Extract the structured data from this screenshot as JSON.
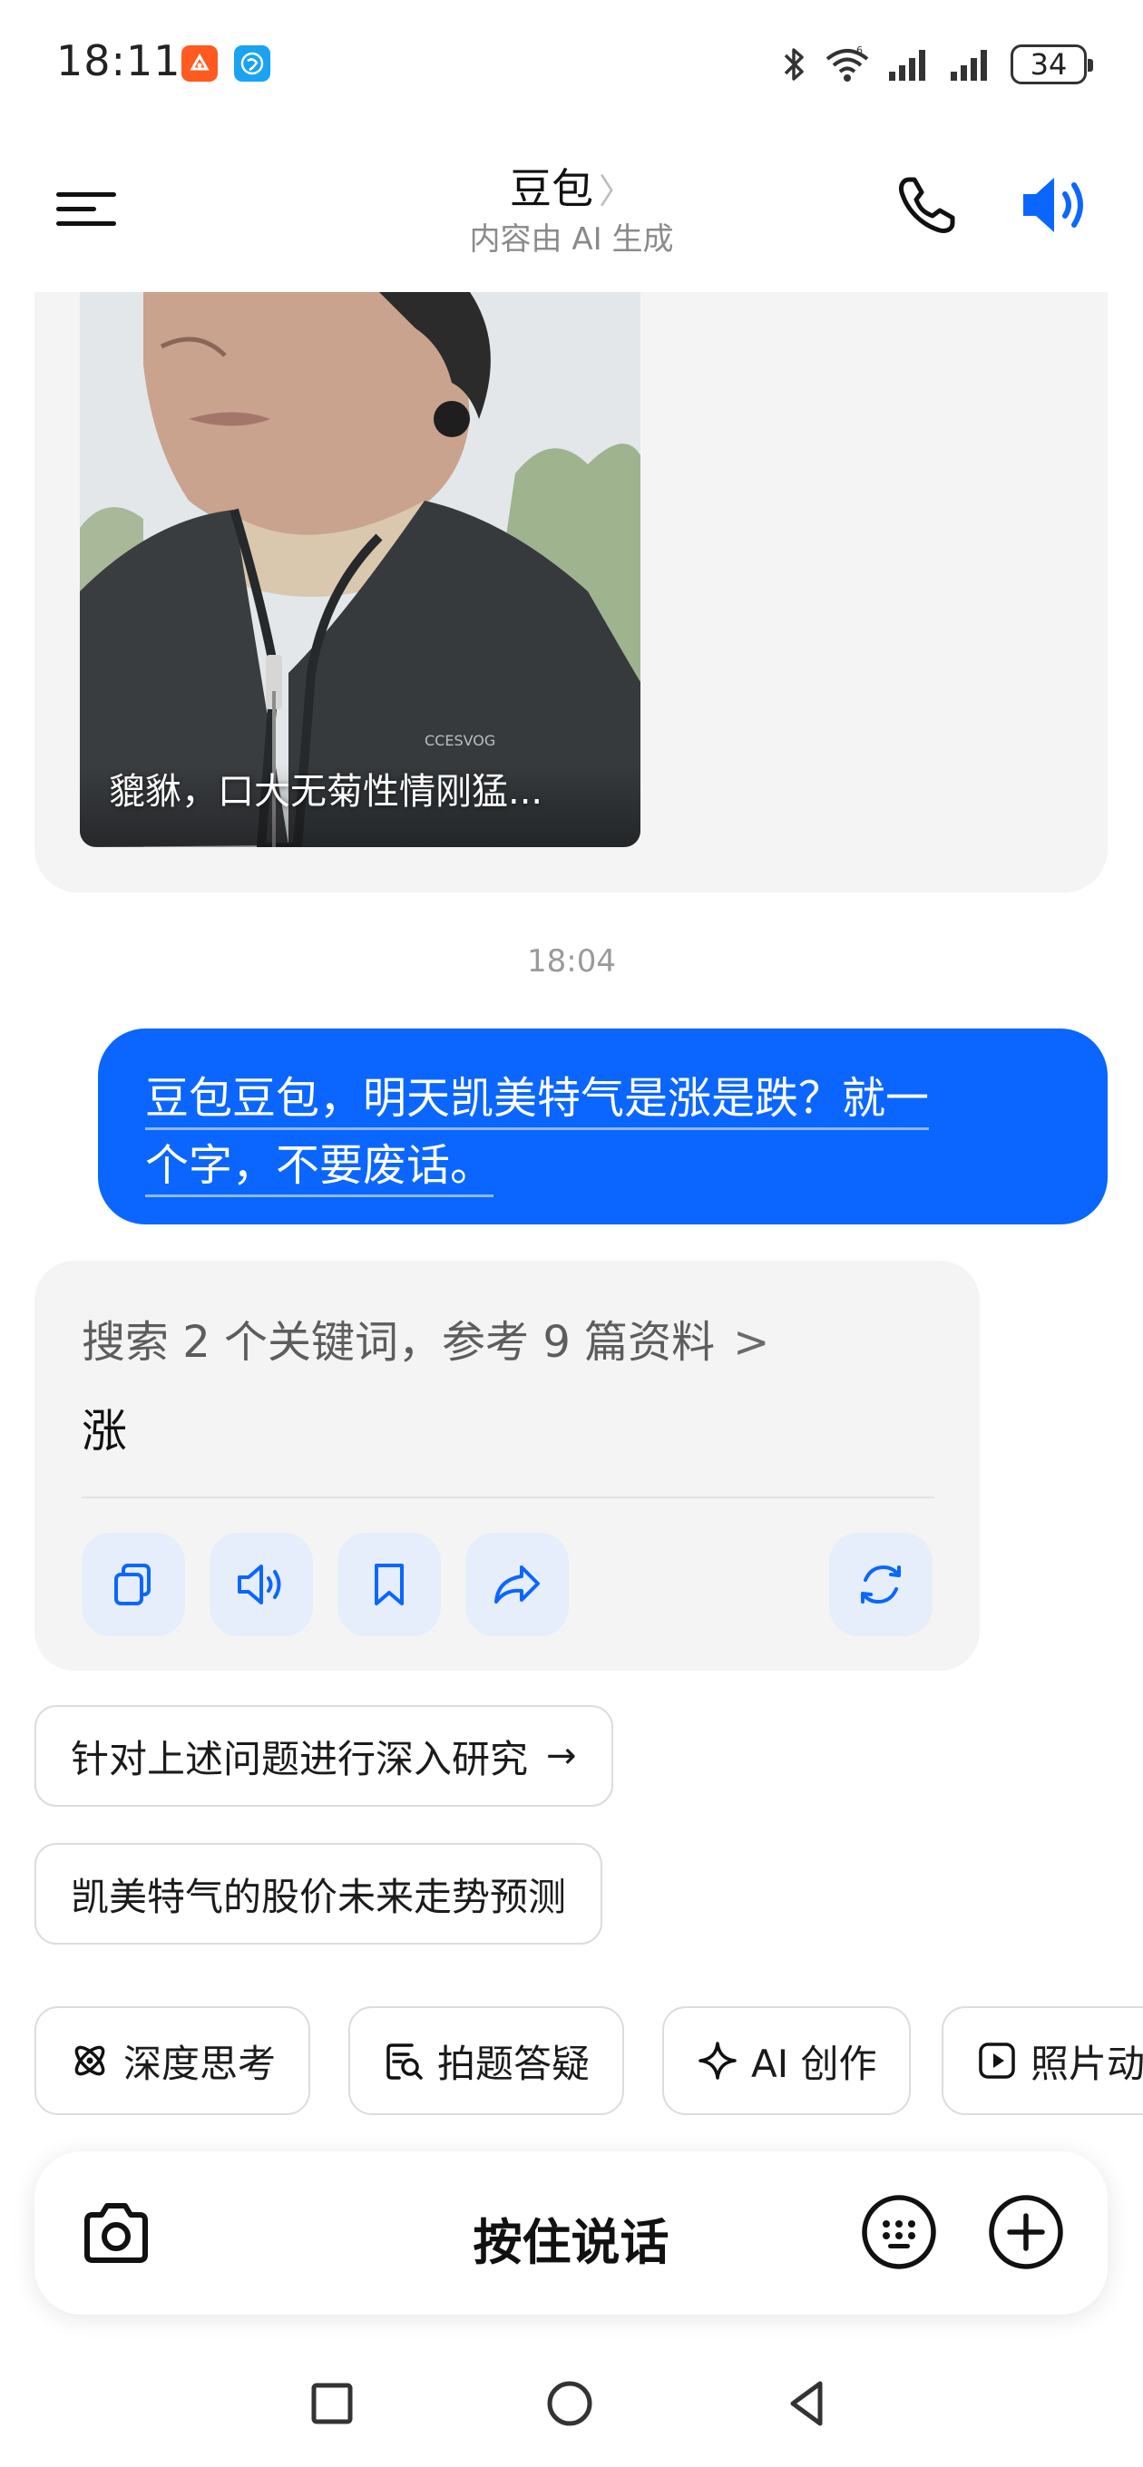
{
  "status_bar": {
    "time": "18:11",
    "battery": "34",
    "icons": [
      "orange-app-icon",
      "browser-app-icon",
      "bluetooth-icon",
      "wifi-icon",
      "signal-icon",
      "signal-icon",
      "battery-icon"
    ]
  },
  "header": {
    "title": "豆包",
    "chevron": "〉",
    "subtitle": "内容由 AI 生成"
  },
  "image_message": {
    "caption": "貔貅，口大无菊性情刚猛...",
    "shirt_text": "CCESVOG"
  },
  "timestamp": "18:04",
  "user_message": {
    "line1": "豆包豆包，明天凯美特气是涨是跌？就一",
    "line2": "个字，不要废话。"
  },
  "ai_reply": {
    "search_summary": "搜索 2 个关键词，参考 9 篇资料",
    "chevron": ">",
    "answer": "涨",
    "actions": [
      "copy-icon",
      "read-aloud-icon",
      "bookmark-icon",
      "share-icon",
      "regenerate-icon"
    ]
  },
  "suggestions": [
    {
      "label": "针对上述问题进行深入研究",
      "arrow": "→"
    },
    {
      "label": "凯美特气的股价未来走势预测"
    }
  ],
  "chips": [
    {
      "label": "深度思考",
      "icon": "atom-icon"
    },
    {
      "label": "拍题答疑",
      "icon": "scan-question-icon"
    },
    {
      "label": "AI 创作",
      "icon": "sparkle-icon"
    },
    {
      "label": "照片动",
      "icon": "play-square-icon"
    }
  ],
  "input_bar": {
    "hold_to_talk": "按住说话"
  },
  "colors": {
    "accent": "#0a66ff",
    "bubble_gray": "#f4f4f4",
    "action_bg": "#e6eefb"
  }
}
